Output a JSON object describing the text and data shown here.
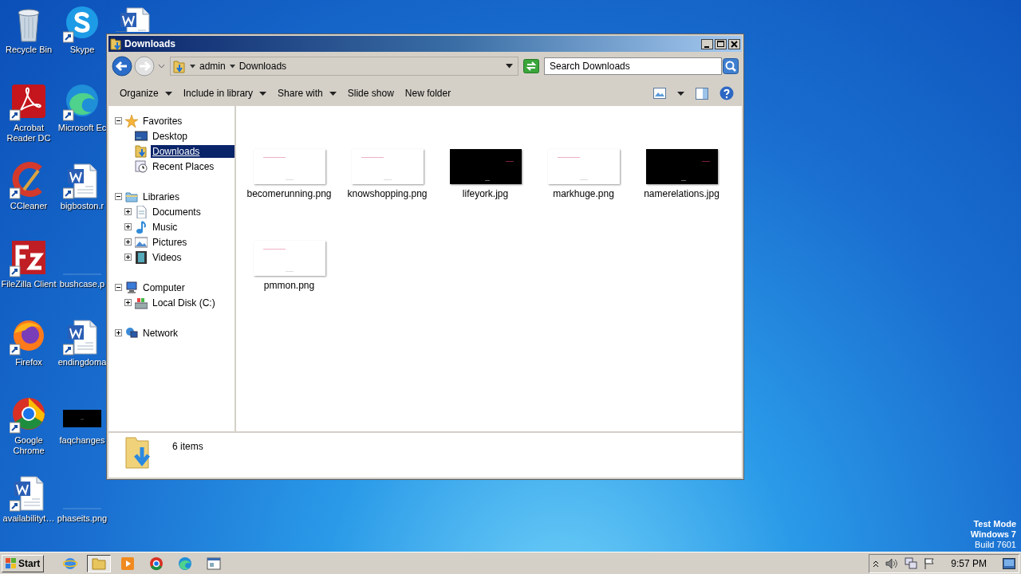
{
  "desktop": {
    "icons": [
      {
        "label": "Recycle Bin",
        "kind": "recycle"
      },
      {
        "label": "Acrobat Reader DC",
        "kind": "acrobat"
      },
      {
        "label": "CCleaner",
        "kind": "ccleaner"
      },
      {
        "label": "FileZilla Client",
        "kind": "filezilla"
      },
      {
        "label": "Firefox",
        "kind": "firefox"
      },
      {
        "label": "Google Chrome",
        "kind": "chrome"
      },
      {
        "label": "availabilityt…",
        "kind": "word"
      },
      {
        "label": "Skype",
        "kind": "skype"
      },
      {
        "label": "Microsoft Ec",
        "kind": "edge"
      },
      {
        "label": "bigboston.r",
        "kind": "word"
      },
      {
        "label": "bushcase.p",
        "kind": "blank"
      },
      {
        "label": "endingdoma",
        "kind": "word"
      },
      {
        "label": "faqchanges",
        "kind": "black"
      },
      {
        "label": "phaseits.png",
        "kind": "blank"
      },
      {
        "kind": "word"
      }
    ]
  },
  "window": {
    "title": "Downloads",
    "address": {
      "segments": [
        "admin",
        "Downloads"
      ]
    },
    "search": {
      "placeholder": "Search Downloads"
    },
    "toolbar": [
      {
        "label": "Organize",
        "dropdown": true
      },
      {
        "label": "Include in library",
        "dropdown": true
      },
      {
        "label": "Share with",
        "dropdown": true
      },
      {
        "label": "Slide show",
        "dropdown": false
      },
      {
        "label": "New folder",
        "dropdown": false
      }
    ],
    "nav": [
      {
        "label": "Favorites",
        "kind": "star",
        "expanded": true,
        "selected": false,
        "children": [
          {
            "label": "Desktop",
            "kind": "desktop",
            "selected": false
          },
          {
            "label": "Downloads",
            "kind": "downloads",
            "selected": true
          },
          {
            "label": "Recent Places",
            "kind": "recent",
            "selected": false
          }
        ]
      },
      {
        "label": "Libraries",
        "kind": "library",
        "expanded": true,
        "selected": false,
        "children": [
          {
            "label": "Documents",
            "kind": "document",
            "expanded": false,
            "selected": false
          },
          {
            "label": "Music",
            "kind": "music",
            "expanded": false,
            "selected": false
          },
          {
            "label": "Pictures",
            "kind": "pictures",
            "expanded": false,
            "selected": false
          },
          {
            "label": "Videos",
            "kind": "videos",
            "expanded": false,
            "selected": false
          }
        ]
      },
      {
        "label": "Computer",
        "kind": "computer",
        "expanded": true,
        "selected": false,
        "children": [
          {
            "label": "Local Disk (C:)",
            "kind": "disk",
            "expanded": false,
            "selected": false
          }
        ]
      },
      {
        "label": "Network",
        "kind": "network",
        "expanded": false,
        "selected": false
      }
    ],
    "files": [
      {
        "name": "becomerunning.png",
        "kind": "light"
      },
      {
        "name": "knowshopping.png",
        "kind": "light"
      },
      {
        "name": "lifeyork.jpg",
        "kind": "dark"
      },
      {
        "name": "markhuge.png",
        "kind": "light"
      },
      {
        "name": "namerelations.jpg",
        "kind": "dark"
      },
      {
        "name": "pmmon.png",
        "kind": "light"
      }
    ],
    "details": {
      "count": "6 items"
    }
  },
  "system": {
    "lines": [
      "Test Mode",
      "Windows 7",
      "Build 7601"
    ]
  },
  "taskbar": {
    "start": "Start",
    "apps": [
      {
        "kind": "ie",
        "active": false
      },
      {
        "kind": "explorer",
        "active": true
      },
      {
        "kind": "media",
        "active": false
      },
      {
        "kind": "chrome",
        "active": false
      },
      {
        "kind": "edge",
        "active": false
      },
      {
        "kind": "window",
        "active": false
      }
    ],
    "clock": "9:57 PM"
  }
}
